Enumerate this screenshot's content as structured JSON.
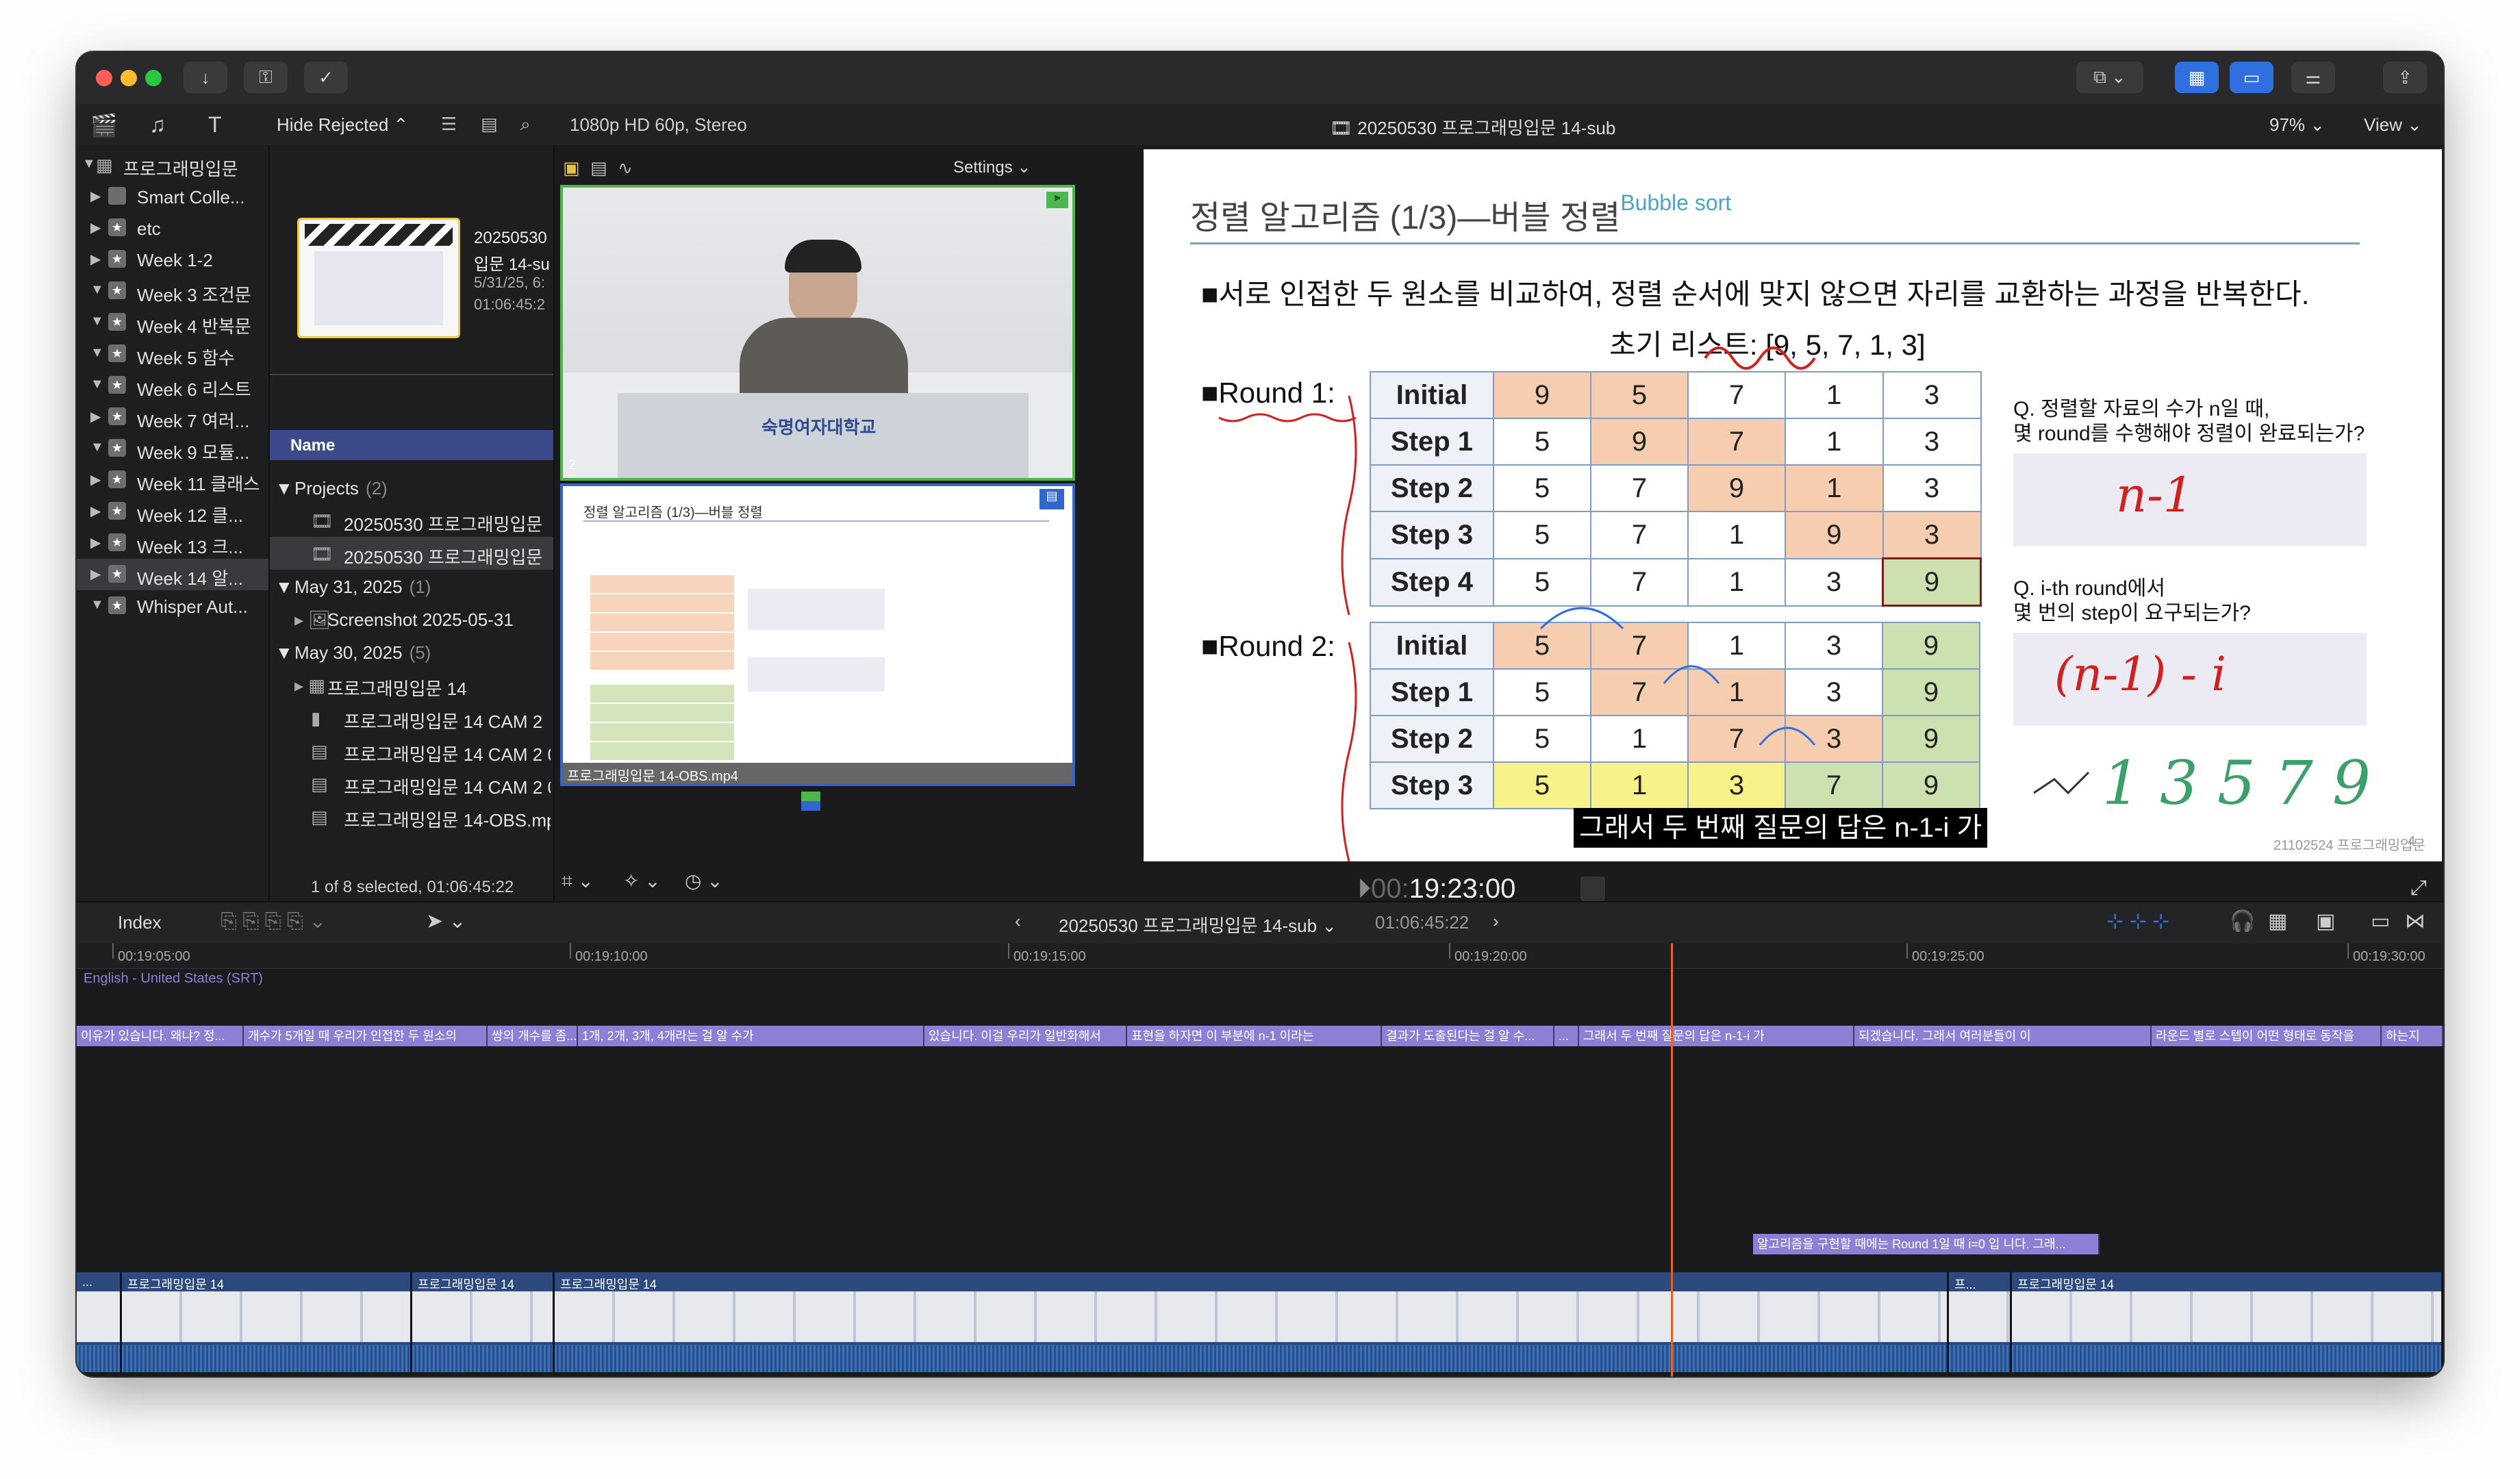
{
  "window": {
    "toolbar": {
      "hide_rejected": "Hide Rejected",
      "format": "1080p HD 60p, Stereo",
      "project_title": "20250530 프로그래밍입문 14-sub",
      "zoom": "97%",
      "view": "View",
      "settings": "Settings"
    }
  },
  "sidebar": {
    "library": "프로그래밍입문",
    "items": [
      {
        "label": "Smart Colle..."
      },
      {
        "label": "etc"
      },
      {
        "label": "Week 1-2"
      },
      {
        "label": "Week 3 조건문"
      },
      {
        "label": "Week 4 반복문"
      },
      {
        "label": "Week 5 함수"
      },
      {
        "label": "Week 6 리스트"
      },
      {
        "label": "Week 7 여러..."
      },
      {
        "label": "Week 9 모듈..."
      },
      {
        "label": "Week 11 클래스"
      },
      {
        "label": "Week 12 클..."
      },
      {
        "label": "Week 13 크..."
      },
      {
        "label": "Week 14 알..."
      },
      {
        "label": "Whisper Aut..."
      }
    ]
  },
  "browser": {
    "filmstrip": {
      "title": "20250530",
      "subtitle": "입문 14-su",
      "date": "5/31/25, 6:",
      "duration": "01:06:45:2"
    },
    "column_name": "Name",
    "groups": [
      {
        "label": "Projects",
        "count": "(2)"
      },
      {
        "label": "May 31, 2025",
        "count": "(1)"
      },
      {
        "label": "May 30, 2025",
        "count": "(5)"
      }
    ],
    "projects": [
      "20250530 프로그래밍입문",
      "20250530 프로그래밍입문"
    ],
    "may31": [
      "Screenshot 2025-05-31"
    ],
    "may30": [
      "프로그래밍입문 14",
      "프로그래밍입문 14 CAM 2",
      "프로그래밍입문 14 CAM 2 0",
      "프로그래밍입문 14 CAM 2 0",
      "프로그래밍입문 14-OBS.mp"
    ],
    "status": "1 of 8 selected, 01:06:45:22"
  },
  "angle_viewer": {
    "angle1_number": "2",
    "angle2_label": "프로그래밍입문 14-OBS.mp4",
    "logo_text": "숙명여자대학교"
  },
  "slide": {
    "title": "정렬 알고리즘 (1/3)—버블 정렬",
    "title_en": "Bubble sort",
    "bullet": "■서로 인접한 두 원소를 비교하여, 정렬 순서에 맞지 않으면 자리를 교환하는 과정을 반복한다.",
    "initial_list": "초기 리스트: [9, 5, 7, 1, 3]",
    "round1_label": "■Round 1:",
    "round2_label": "■Round 2:",
    "round1": [
      {
        "step": "Initial",
        "values": [
          "9",
          "5",
          "7",
          "1",
          "3"
        ]
      },
      {
        "step": "Step 1",
        "values": [
          "5",
          "9",
          "7",
          "1",
          "3"
        ]
      },
      {
        "step": "Step 2",
        "values": [
          "5",
          "7",
          "9",
          "1",
          "3"
        ]
      },
      {
        "step": "Step 3",
        "values": [
          "5",
          "7",
          "1",
          "9",
          "3"
        ]
      },
      {
        "step": "Step 4",
        "values": [
          "5",
          "7",
          "1",
          "3",
          "9"
        ]
      }
    ],
    "round2": [
      {
        "step": "Initial",
        "values": [
          "5",
          "7",
          "1",
          "3",
          "9"
        ]
      },
      {
        "step": "Step 1",
        "values": [
          "5",
          "7",
          "1",
          "3",
          "9"
        ]
      },
      {
        "step": "Step 2",
        "values": [
          "5",
          "1",
          "7",
          "3",
          "9"
        ]
      },
      {
        "step": "Step 3",
        "values": [
          "5",
          "1",
          "3",
          "7",
          "9"
        ]
      }
    ],
    "q1_line1": "Q. 정렬할 자료의 수가 n일 때,",
    "q1_line2": "몇 round를 수행해야 정렬이 완료되는가?",
    "q2_line1": "Q. i-th round에서",
    "q2_line2": "몇 번의 step이 요구되는가?",
    "answer1": "n-1",
    "answer2": "(n-1) - i",
    "handwritten_nums": "1 3 5 7 9",
    "footer": "21102524 프로그래밍입문",
    "page": "4",
    "subtitle": "그래서 두 번째 질문의 답은 n-1-i 가"
  },
  "viewer": {
    "timecode_dim": "00:",
    "timecode": "19:23:00"
  },
  "timeline_bar": {
    "index": "Index",
    "project": "20250530 프로그래밍입문 14-sub",
    "duration": "01:06:45:22"
  },
  "timeline": {
    "ruler": [
      "00:19:05:00",
      "00:19:10:00",
      "00:19:15:00",
      "00:19:20:00",
      "00:19:25:00",
      "00:19:30:00"
    ],
    "caption_lane_label": "English - United States (SRT)",
    "captions": [
      "이유가 있습니다. 왜냐? 정...",
      "개수가 5개일 때 우리가 인접한 두 원소의",
      "쌍의 개수를 좀...",
      "1개, 2개, 3개, 4개라는 걸 알 수가",
      "있습니다. 이걸 우리가 일반화해서",
      "표현을 하자면 이 부분에 n-1 이라는",
      "결과가 도출된다는 걸 알 수...",
      "...",
      "그래서 두 번째 질문의 답은 n-1-i 가",
      "되겠습니다. 그래서 여러분들이 이",
      "라운드 별로 스텝이 어떤 형태로 동작을",
      "하는지"
    ],
    "connected_caption": "알고리즘을 구현할 때에는 Round 1일 때 i=0 입 니다. 그래...",
    "clips": [
      "...",
      "프로그래밍입문 14",
      "프로그래밍입문 14",
      "프로그래밍입문 14",
      "프...",
      "프로그래밍입문 14"
    ]
  },
  "colors": {
    "accent_blue": "#2f6fe0",
    "selection": "#3c4a8c",
    "playhead": "#e3641e",
    "caption_purple": "#8c7fd6",
    "cell_orange": "#f7cdb0",
    "cell_green": "#cde0b0",
    "cell_yellow": "#f7f28a"
  }
}
